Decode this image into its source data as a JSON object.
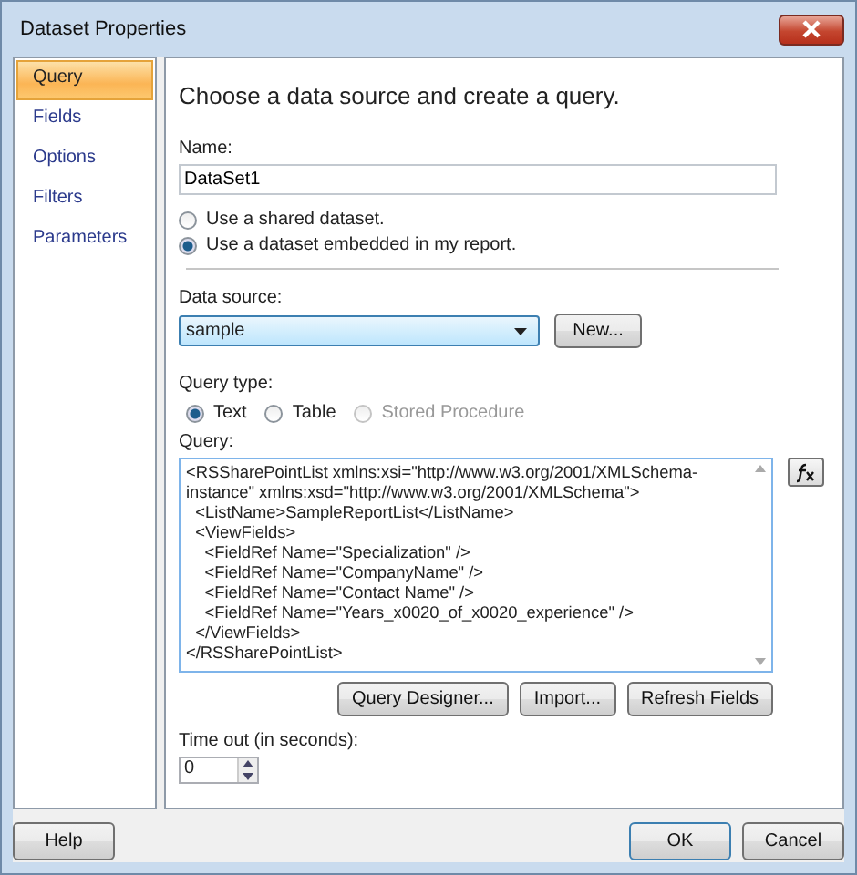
{
  "window": {
    "title": "Dataset Properties"
  },
  "sidebar": {
    "items": [
      {
        "label": "Query",
        "selected": true
      },
      {
        "label": "Fields",
        "selected": false
      },
      {
        "label": "Options",
        "selected": false
      },
      {
        "label": "Filters",
        "selected": false
      },
      {
        "label": "Parameters",
        "selected": false
      }
    ]
  },
  "heading": "Choose a data source and create a query.",
  "name_field": {
    "label": "Name:",
    "value": "DataSet1"
  },
  "dataset_options": [
    {
      "label": "Use a shared dataset.",
      "selected": false
    },
    {
      "label": "Use a dataset embedded in my report.",
      "selected": true
    }
  ],
  "data_source": {
    "label": "Data source:",
    "value": "sample",
    "button": "New..."
  },
  "query_type": {
    "label": "Query type:",
    "options": [
      {
        "label": "Text",
        "selected": true,
        "disabled": false
      },
      {
        "label": "Table",
        "selected": false,
        "disabled": false
      },
      {
        "label": "Stored Procedure",
        "selected": false,
        "disabled": true
      }
    ]
  },
  "query": {
    "label": "Query:",
    "lines": [
      "<RSSharePointList xmlns:xsi=\"http://www.w3.org/2001/XMLSchema-",
      "instance\" xmlns:xsd=\"http://www.w3.org/2001/XMLSchema\">",
      "  <ListName>SampleReportList</ListName>",
      "  <ViewFields>",
      "    <FieldRef Name=\"Specialization\" />",
      "    <FieldRef Name=\"CompanyName\" />",
      "    <FieldRef Name=\"Contact Name\" />",
      "    <FieldRef Name=\"Years_x0020_of_x0020_experience\" />",
      "  </ViewFields>",
      "</RSSharePointList>"
    ]
  },
  "query_buttons": [
    "Query Designer...",
    "Import...",
    "Refresh Fields"
  ],
  "timeout": {
    "label": "Time out (in seconds):",
    "value": "0"
  },
  "footer": {
    "help": "Help",
    "ok": "OK",
    "cancel": "Cancel"
  }
}
